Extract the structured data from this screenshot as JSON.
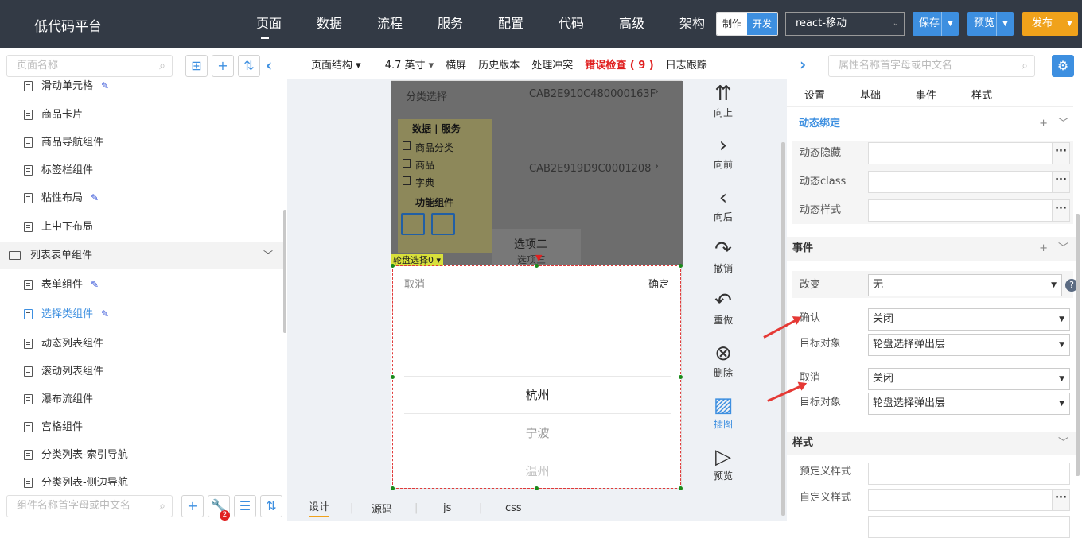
{
  "app": {
    "title": "低代码平台"
  },
  "nav": [
    "页面",
    "数据",
    "流程",
    "服务",
    "配置",
    "代码",
    "高级",
    "架构"
  ],
  "mode": {
    "make": "制作",
    "dev": "开发"
  },
  "template": "react-移动",
  "top_buttons": {
    "save": "保存",
    "preview": "预览",
    "publish": "发布"
  },
  "colors": {
    "topbar": "#333a45",
    "accent": "#3d8fe0",
    "publish": "#f0a21b",
    "error": "#e02020"
  },
  "left": {
    "page_search_placeholder": "页面名称",
    "component_search_placeholder": "组件名称首字母或中文名",
    "badge": "2",
    "items": [
      {
        "label": "滑动单元格",
        "pen": true
      },
      {
        "label": "商品卡片"
      },
      {
        "label": "商品导航组件"
      },
      {
        "label": "标签栏组件"
      },
      {
        "label": "粘性布局",
        "pen": true
      },
      {
        "label": "上中下布局"
      },
      {
        "label": "列表表单组件",
        "group": true
      },
      {
        "label": "表单组件",
        "pen": true
      },
      {
        "label": "选择类组件",
        "pen": true,
        "selected": true
      },
      {
        "label": "动态列表组件"
      },
      {
        "label": "滚动列表组件"
      },
      {
        "label": "瀑布流组件"
      },
      {
        "label": "宫格组件"
      },
      {
        "label": "分类列表-索引导航"
      },
      {
        "label": "分类列表-侧边导航"
      }
    ]
  },
  "center": {
    "toolbar": {
      "structure": "页面结构",
      "size": "4.7 英寸",
      "landscape": "横屏",
      "history": "历史版本",
      "conflict": "处理冲突",
      "errors": "错误检查 ( 9 )",
      "log": "日志跟踪"
    },
    "phone": {
      "row1_label": "分类选择",
      "row1_value": "CAB2E910C480000163F",
      "row2_value": "CAB2E919D9C0001208",
      "drag_header": "数据 | 服务",
      "drag_items": [
        "商品分类",
        "商品",
        "字典"
      ],
      "drag_func": "功能组件",
      "option_label": "选项二",
      "option_label2": "选项三",
      "tag": "轮盘选择0",
      "cancel": "取消",
      "confirm": "确定",
      "options": [
        "杭州",
        "宁波",
        "温州"
      ]
    },
    "actions": [
      {
        "icon": "move-up-icon",
        "glyph": "⇈",
        "label": "向上"
      },
      {
        "icon": "forward-icon",
        "glyph": "›",
        "label": "向前"
      },
      {
        "icon": "back-icon",
        "glyph": "‹",
        "label": "向后"
      },
      {
        "icon": "undo-icon",
        "glyph": "↷",
        "label": "撤销"
      },
      {
        "icon": "redo-icon",
        "glyph": "↶",
        "label": "重做"
      },
      {
        "icon": "delete-icon",
        "glyph": "⊗",
        "label": "删除"
      },
      {
        "icon": "image-icon",
        "glyph": "▨",
        "label": "插图"
      },
      {
        "icon": "preview-icon",
        "glyph": "▷",
        "label": "预览"
      }
    ],
    "tabs": [
      "设计",
      "源码",
      "js",
      "css"
    ]
  },
  "right": {
    "search_placeholder": "属性名称首字母或中文名",
    "tabs": [
      "设置",
      "基础",
      "事件",
      "样式"
    ],
    "dynamic": {
      "title": "动态绑定",
      "rows": [
        "动态隐藏",
        "动态class",
        "动态样式"
      ]
    },
    "events": {
      "title": "事件",
      "change_label": "改变",
      "change_value": "无",
      "confirm_label": "确认",
      "confirm_value": "关闭",
      "target_label": "目标对象",
      "target_value": "轮盘选择弹出层",
      "cancel_label": "取消",
      "cancel_value": "关闭",
      "target2_value": "轮盘选择弹出层"
    },
    "style": {
      "title": "样式",
      "predefined": "预定义样式",
      "custom": "自定义样式"
    }
  }
}
